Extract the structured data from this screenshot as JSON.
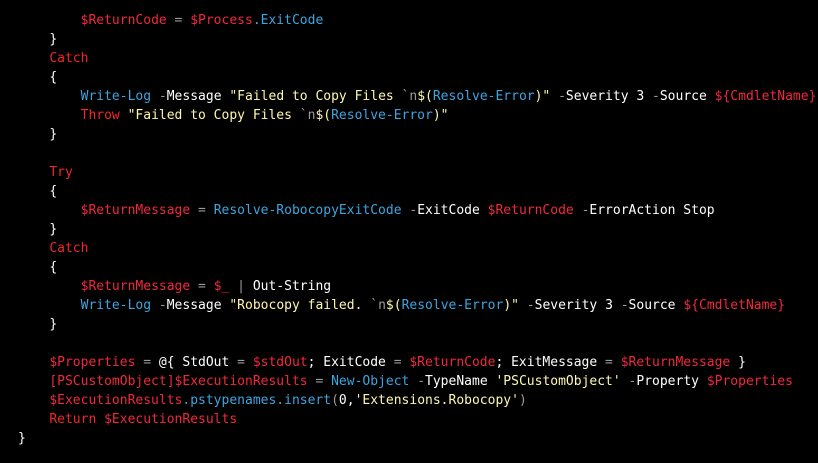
{
  "colors": {
    "background": "#000000",
    "default": "#FFFFFF",
    "keyword": "#F02727",
    "variable": "#F0283C",
    "cmdlet": "#3DA5E0",
    "string": "#FFF7B0",
    "punct": "#9B9B9B"
  },
  "lines": [
    {
      "indent": 8,
      "tokens": [
        {
          "t": "variable",
          "v": "$ReturnCode"
        },
        {
          "t": "default",
          "v": " "
        },
        {
          "t": "punct",
          "v": "="
        },
        {
          "t": "default",
          "v": " "
        },
        {
          "t": "variable",
          "v": "$Process"
        },
        {
          "t": "cmdlet",
          "v": ".ExitCode"
        }
      ]
    },
    {
      "indent": 4,
      "tokens": [
        {
          "t": "default",
          "v": "}"
        }
      ]
    },
    {
      "indent": 4,
      "tokens": [
        {
          "t": "keyword",
          "v": "Catch"
        }
      ]
    },
    {
      "indent": 4,
      "tokens": [
        {
          "t": "default",
          "v": "{"
        }
      ]
    },
    {
      "indent": 8,
      "tokens": [
        {
          "t": "cmdlet",
          "v": "Write-Log"
        },
        {
          "t": "default",
          "v": " "
        },
        {
          "t": "punct",
          "v": "-"
        },
        {
          "t": "default",
          "v": "Message "
        },
        {
          "t": "string",
          "v": "\"Failed to Copy Files "
        },
        {
          "t": "punct",
          "v": "`n"
        },
        {
          "t": "string",
          "v": "$("
        },
        {
          "t": "cmdlet",
          "v": "Resolve-Error"
        },
        {
          "t": "string",
          "v": ")\""
        },
        {
          "t": "default",
          "v": " "
        },
        {
          "t": "punct",
          "v": "-"
        },
        {
          "t": "default",
          "v": "Severity 3 "
        },
        {
          "t": "punct",
          "v": "-"
        },
        {
          "t": "default",
          "v": "Source "
        },
        {
          "t": "variable",
          "v": "${CmdletName}"
        }
      ]
    },
    {
      "indent": 8,
      "tokens": [
        {
          "t": "keyword",
          "v": "Throw"
        },
        {
          "t": "default",
          "v": " "
        },
        {
          "t": "string",
          "v": "\"Failed to Copy Files "
        },
        {
          "t": "punct",
          "v": "`n"
        },
        {
          "t": "string",
          "v": "$("
        },
        {
          "t": "cmdlet",
          "v": "Resolve-Error"
        },
        {
          "t": "string",
          "v": ")\""
        }
      ]
    },
    {
      "indent": 4,
      "tokens": [
        {
          "t": "default",
          "v": "}"
        }
      ]
    },
    {
      "indent": 0,
      "tokens": []
    },
    {
      "indent": 4,
      "tokens": [
        {
          "t": "keyword",
          "v": "Try"
        }
      ]
    },
    {
      "indent": 4,
      "tokens": [
        {
          "t": "default",
          "v": "{"
        }
      ]
    },
    {
      "indent": 8,
      "tokens": [
        {
          "t": "variable",
          "v": "$ReturnMessage"
        },
        {
          "t": "default",
          "v": " "
        },
        {
          "t": "punct",
          "v": "="
        },
        {
          "t": "default",
          "v": " "
        },
        {
          "t": "cmdlet",
          "v": "Resolve-RobocopyExitCode"
        },
        {
          "t": "default",
          "v": " "
        },
        {
          "t": "punct",
          "v": "-"
        },
        {
          "t": "default",
          "v": "ExitCode "
        },
        {
          "t": "variable",
          "v": "$ReturnCode"
        },
        {
          "t": "default",
          "v": " "
        },
        {
          "t": "punct",
          "v": "-"
        },
        {
          "t": "default",
          "v": "ErrorAction Stop"
        }
      ]
    },
    {
      "indent": 4,
      "tokens": [
        {
          "t": "default",
          "v": "}"
        }
      ]
    },
    {
      "indent": 4,
      "tokens": [
        {
          "t": "keyword",
          "v": "Catch"
        }
      ]
    },
    {
      "indent": 4,
      "tokens": [
        {
          "t": "default",
          "v": "{"
        }
      ]
    },
    {
      "indent": 8,
      "tokens": [
        {
          "t": "variable",
          "v": "$ReturnMessage"
        },
        {
          "t": "default",
          "v": " "
        },
        {
          "t": "punct",
          "v": "="
        },
        {
          "t": "default",
          "v": " "
        },
        {
          "t": "variable",
          "v": "$_"
        },
        {
          "t": "default",
          "v": " "
        },
        {
          "t": "punct",
          "v": "|"
        },
        {
          "t": "default",
          "v": " Out-String"
        }
      ]
    },
    {
      "indent": 8,
      "tokens": [
        {
          "t": "cmdlet",
          "v": "Write-Log"
        },
        {
          "t": "default",
          "v": " "
        },
        {
          "t": "punct",
          "v": "-"
        },
        {
          "t": "default",
          "v": "Message "
        },
        {
          "t": "string",
          "v": "\"Robocopy failed. "
        },
        {
          "t": "punct",
          "v": "`n"
        },
        {
          "t": "string",
          "v": "$("
        },
        {
          "t": "cmdlet",
          "v": "Resolve-Error"
        },
        {
          "t": "string",
          "v": ")\""
        },
        {
          "t": "default",
          "v": " "
        },
        {
          "t": "punct",
          "v": "-"
        },
        {
          "t": "default",
          "v": "Severity 3 "
        },
        {
          "t": "punct",
          "v": "-"
        },
        {
          "t": "default",
          "v": "Source "
        },
        {
          "t": "variable",
          "v": "${CmdletName}"
        }
      ]
    },
    {
      "indent": 4,
      "tokens": [
        {
          "t": "default",
          "v": "}"
        }
      ]
    },
    {
      "indent": 0,
      "tokens": []
    },
    {
      "indent": 4,
      "tokens": [
        {
          "t": "variable",
          "v": "$Properties"
        },
        {
          "t": "default",
          "v": " "
        },
        {
          "t": "punct",
          "v": "="
        },
        {
          "t": "default",
          "v": " @{ StdOut "
        },
        {
          "t": "punct",
          "v": "="
        },
        {
          "t": "default",
          "v": " "
        },
        {
          "t": "variable",
          "v": "$stdOut"
        },
        {
          "t": "default",
          "v": "; ExitCode "
        },
        {
          "t": "punct",
          "v": "="
        },
        {
          "t": "default",
          "v": " "
        },
        {
          "t": "variable",
          "v": "$ReturnCode"
        },
        {
          "t": "default",
          "v": "; ExitMessage "
        },
        {
          "t": "punct",
          "v": "="
        },
        {
          "t": "default",
          "v": " "
        },
        {
          "t": "variable",
          "v": "$ReturnMessage"
        },
        {
          "t": "default",
          "v": " }"
        }
      ]
    },
    {
      "indent": 4,
      "tokens": [
        {
          "t": "type",
          "v": "[PSCustomObject]"
        },
        {
          "t": "variable",
          "v": "$ExecutionResults"
        },
        {
          "t": "default",
          "v": " "
        },
        {
          "t": "punct",
          "v": "="
        },
        {
          "t": "default",
          "v": " "
        },
        {
          "t": "cmdlet",
          "v": "New-Object"
        },
        {
          "t": "default",
          "v": " "
        },
        {
          "t": "punct",
          "v": "-"
        },
        {
          "t": "default",
          "v": "TypeName "
        },
        {
          "t": "string",
          "v": "'PSCustomObject'"
        },
        {
          "t": "default",
          "v": " "
        },
        {
          "t": "punct",
          "v": "-"
        },
        {
          "t": "default",
          "v": "Property "
        },
        {
          "t": "variable",
          "v": "$Properties"
        }
      ]
    },
    {
      "indent": 4,
      "tokens": [
        {
          "t": "variable",
          "v": "$ExecutionResults"
        },
        {
          "t": "cmdlet",
          "v": ".pstypenames.insert"
        },
        {
          "t": "punct",
          "v": "("
        },
        {
          "t": "default",
          "v": "0,"
        },
        {
          "t": "string",
          "v": "'Extensions.Robocopy'"
        },
        {
          "t": "punct",
          "v": ")"
        }
      ]
    },
    {
      "indent": 4,
      "tokens": [
        {
          "t": "keyword",
          "v": "Return"
        },
        {
          "t": "default",
          "v": " "
        },
        {
          "t": "variable",
          "v": "$ExecutionResults"
        }
      ]
    },
    {
      "indent": 0,
      "tokens": [
        {
          "t": "default",
          "v": "}"
        }
      ]
    }
  ]
}
